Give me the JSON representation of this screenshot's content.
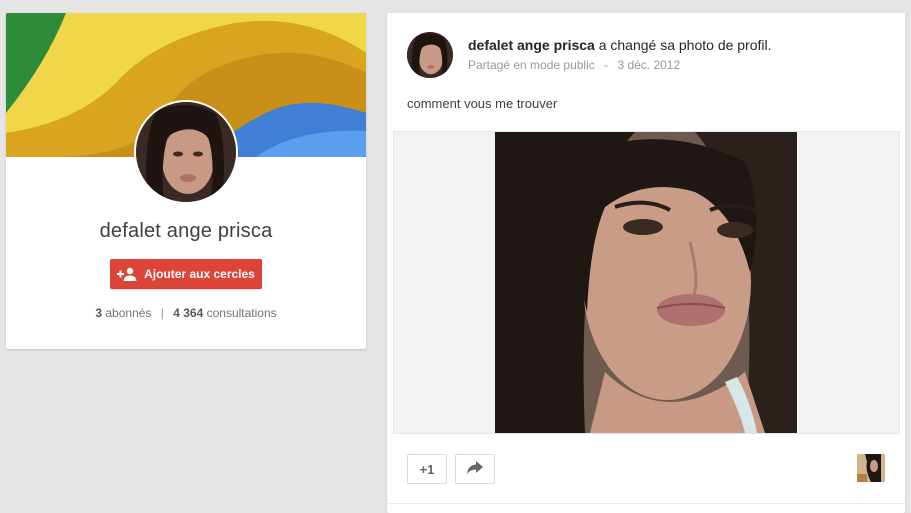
{
  "profile": {
    "name": "defalet ange prisca",
    "add_button_label": "Ajouter aux cercles",
    "followers_count": "3",
    "followers_label": "abonnés",
    "separator": "|",
    "views_count": "4 364",
    "views_label": "consultations",
    "cover_icon": "abstract-wave-cover",
    "avatar_icon": "profile-photo",
    "add_icon": "add-person-icon"
  },
  "post": {
    "author": "defalet ange prisca",
    "action_text": " a changé sa photo de profil.",
    "visibility": "Partagé en mode public",
    "meta_separator": "-",
    "date": "3 déc. 2012",
    "text": "comment vous me trouver",
    "plus_one_label": "+1",
    "share_icon": "share-arrow-icon"
  },
  "colors": {
    "accent_red": "#db4437",
    "background": "#e5e5e5",
    "card": "#ffffff"
  }
}
